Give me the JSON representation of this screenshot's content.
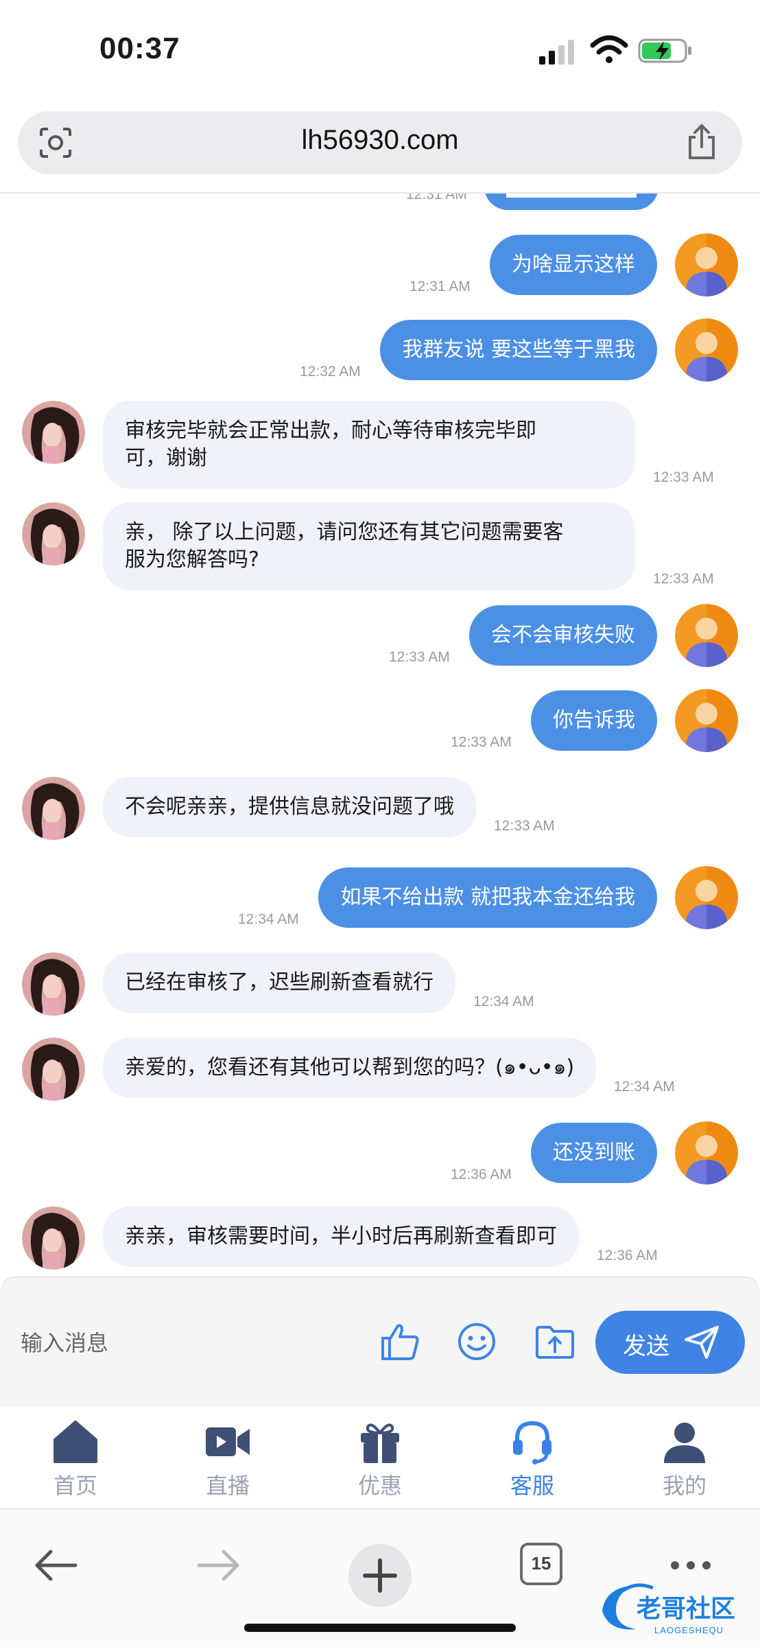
{
  "status": {
    "time": "00:37"
  },
  "browser": {
    "url": "lh56930.com",
    "tabs_count": "15"
  },
  "messages": [
    {
      "side": "out",
      "text": "为啥显示这样",
      "time": "12:31 AM"
    },
    {
      "side": "out",
      "text": "我群友说 要这些等于黑我",
      "time": "12:32 AM"
    },
    {
      "side": "in",
      "lines": [
        "审核完毕就会正常出款，耐心等待审核完毕即",
        "可，谢谢"
      ],
      "time": "12:33 AM"
    },
    {
      "side": "in",
      "lines": [
        "亲， 除了以上问题，请问您还有其它问题需要客",
        "服为您解答吗?"
      ],
      "time": "12:33 AM"
    },
    {
      "side": "out",
      "text": "会不会审核失败",
      "time": "12:33 AM"
    },
    {
      "side": "out",
      "text": "你告诉我",
      "time": "12:33 AM"
    },
    {
      "side": "in",
      "text": "不会呢亲亲，提供信息就没问题了哦",
      "time": "12:33 AM"
    },
    {
      "side": "out",
      "text": "如果不给出款 就把我本金还给我",
      "time": "12:34 AM"
    },
    {
      "side": "in",
      "text": "已经在审核了，迟些刷新查看就行",
      "time": "12:34 AM"
    },
    {
      "side": "in",
      "text": "亲爱的，您看还有其他可以帮到您的吗？(๑•ᴗ•๑)",
      "time": "12:34 AM"
    },
    {
      "side": "out",
      "text": "还没到账",
      "time": "12:36 AM"
    },
    {
      "side": "in",
      "text": "亲亲，审核需要时间，半小时后再刷新查看即可",
      "time": "12:36 AM"
    }
  ],
  "partial_top_time": "12:31 AM",
  "composer": {
    "placeholder": "输入消息",
    "send_label": "发送"
  },
  "nav": [
    {
      "label": "首页",
      "icon": "home-icon"
    },
    {
      "label": "直播",
      "icon": "video-icon"
    },
    {
      "label": "优惠",
      "icon": "gift-icon"
    },
    {
      "label": "客服",
      "icon": "headset-icon",
      "active": true
    },
    {
      "label": "我的",
      "icon": "user-icon"
    }
  ],
  "watermark": {
    "text": "老哥社区",
    "sub": "LAOGESHEQU"
  },
  "colors": {
    "accent": "#3f84e5",
    "bubble_out": "#4c90e6",
    "bubble_in": "#eff2f8"
  }
}
